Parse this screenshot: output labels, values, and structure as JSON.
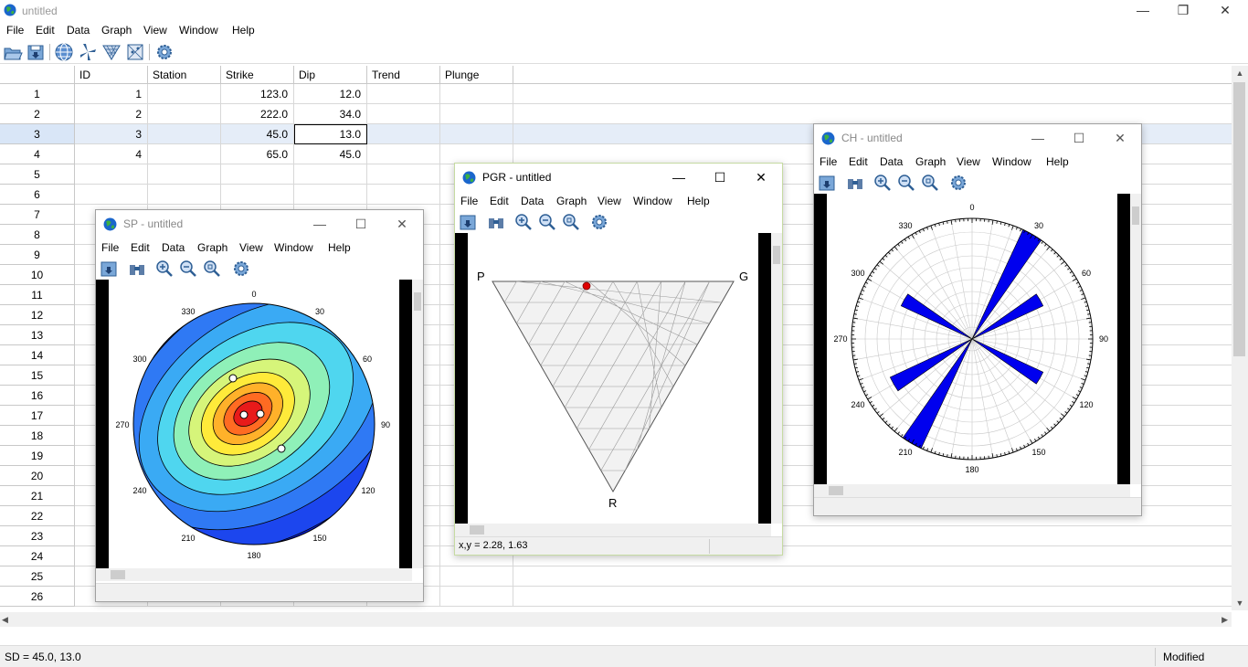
{
  "app": {
    "title": "untitled",
    "menu": [
      "File",
      "Edit",
      "Data",
      "Graph",
      "View",
      "Window",
      "Help"
    ],
    "toolbar_icons": [
      "open-icon",
      "save-icon",
      "globe-icon",
      "rose-icon",
      "triangle-icon",
      "grid-icon",
      "settings-icon"
    ]
  },
  "table": {
    "columns": [
      "ID",
      "Station",
      "Strike",
      "Dip",
      "Trend",
      "Plunge"
    ],
    "row_numbers": [
      "1",
      "2",
      "3",
      "4",
      "5",
      "6",
      "7",
      "8",
      "9",
      "10",
      "11",
      "12",
      "13",
      "14",
      "15",
      "16",
      "17",
      "18",
      "19",
      "20",
      "21",
      "22",
      "23",
      "24",
      "25",
      "26"
    ],
    "rows": [
      {
        "id": "1",
        "station": "",
        "strike": "123.0",
        "dip": "12.0",
        "trend": "",
        "plunge": ""
      },
      {
        "id": "2",
        "station": "",
        "strike": "222.0",
        "dip": "34.0",
        "trend": "",
        "plunge": ""
      },
      {
        "id": "3",
        "station": "",
        "strike": "45.0",
        "dip": "13.0",
        "trend": "",
        "plunge": ""
      },
      {
        "id": "4",
        "station": "",
        "strike": "65.0",
        "dip": "45.0",
        "trend": "",
        "plunge": ""
      }
    ],
    "selected_row": 3
  },
  "status": {
    "left": "SD = 45.0, 13.0",
    "right": "Modified"
  },
  "windows": {
    "sp": {
      "title": "SP - untitled",
      "menu": [
        "File",
        "Edit",
        "Data",
        "Graph",
        "View",
        "Window",
        "Help"
      ],
      "status": "",
      "degree_labels": [
        "0",
        "30",
        "60",
        "90",
        "120",
        "150",
        "180",
        "210",
        "240",
        "270",
        "300",
        "330"
      ]
    },
    "pgr": {
      "title": "PGR - untitled",
      "menu": [
        "File",
        "Edit",
        "Data",
        "Graph",
        "View",
        "Window",
        "Help"
      ],
      "status": "x,y = 2.28, 1.63",
      "vertices": [
        "P",
        "G",
        "R"
      ]
    },
    "ch": {
      "title": "CH - untitled",
      "menu": [
        "File",
        "Edit",
        "Data",
        "Graph",
        "View",
        "Window",
        "Help"
      ],
      "status": "",
      "degree_labels": [
        "0",
        "30",
        "60",
        "90",
        "120",
        "150",
        "180",
        "210",
        "240",
        "270",
        "300",
        "330"
      ],
      "rose_bins": [
        {
          "azimuth": 30,
          "length": 1.0
        },
        {
          "azimuth": 60,
          "length": 0.65
        },
        {
          "azimuth": 120,
          "length": 0.65
        },
        {
          "azimuth": 210,
          "length": 1.0
        },
        {
          "azimuth": 240,
          "length": 0.75
        },
        {
          "azimuth": 300,
          "length": 0.65
        }
      ]
    }
  },
  "colors": {
    "rose_fill": "#0000ee",
    "selection": "#e5edf8",
    "active_border": "#c6dba2"
  }
}
